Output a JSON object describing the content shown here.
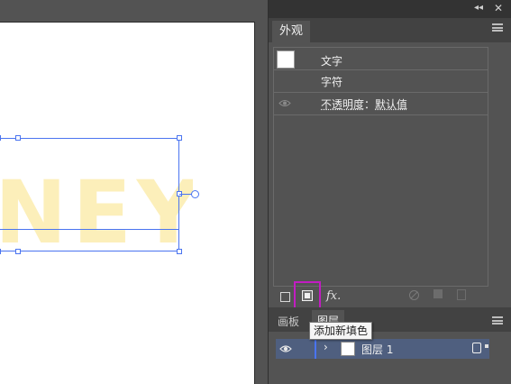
{
  "canvas": {
    "artwork_text": "NEY"
  },
  "appearance_panel": {
    "tab_label": "外观",
    "rows": {
      "type_label": "文字",
      "character_label": "字符",
      "opacity_label": "不透明度",
      "opacity_separator": "：",
      "opacity_value": "默认值"
    },
    "toolbar": {
      "fx_label": "fx."
    }
  },
  "layers_panel": {
    "tabs": {
      "artboards": "画板",
      "layers": "图层"
    },
    "layer": {
      "name": "图层 1",
      "expand_glyph": "›"
    }
  },
  "dock": {
    "collapse_glyph": "◂◂",
    "close_glyph": "✕"
  },
  "tooltip": {
    "text": "添加新填色"
  },
  "colors": {
    "selection": "#4a74f0",
    "artwork_fill": "#fcefba",
    "highlight_border": "#c21cc2",
    "layer_row": "#4f5f7f"
  },
  "icons": [
    "eye-icon",
    "menu-icon",
    "add-stroke-icon",
    "add-fill-icon",
    "fx-icon",
    "clear-icon",
    "duplicate-icon",
    "trash-icon",
    "layer-target-icon"
  ]
}
